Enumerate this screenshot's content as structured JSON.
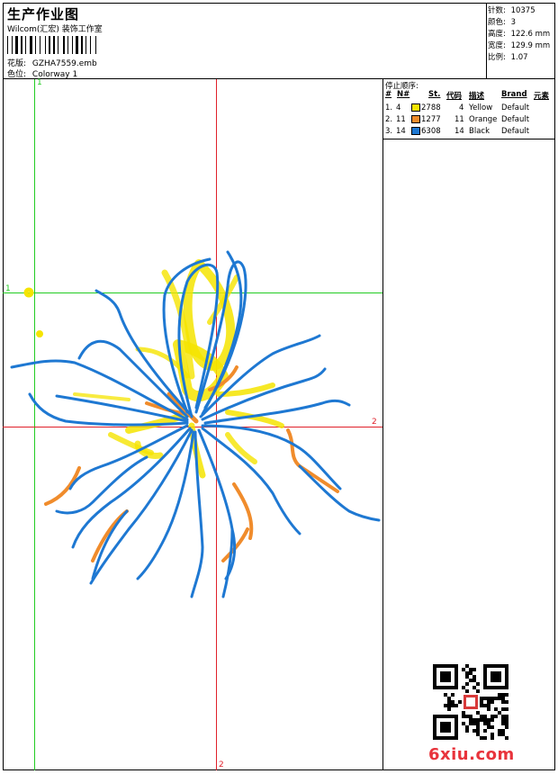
{
  "header": {
    "title": "生产作业图",
    "studio": "Wilcom(汇宏) 装饰工作室",
    "design_label": "花版:",
    "design_value": "GZHA7559.emb",
    "colorway_label": "色位:",
    "colorway_value": "Colorway 1"
  },
  "stats": [
    {
      "label": "针数:",
      "value": "10375"
    },
    {
      "label": "颜色:",
      "value": "3"
    },
    {
      "label": "高度:",
      "value": "122.6 mm"
    },
    {
      "label": "宽度:",
      "value": "129.9 mm"
    },
    {
      "label": "比例:",
      "value": "1.07"
    }
  ],
  "stop_sequence": {
    "title": "停止顺序:",
    "columns": [
      "#",
      "N#",
      "St.",
      "代码",
      "描述",
      "Brand",
      "元素"
    ],
    "rows": [
      {
        "idx": "1.",
        "n": "4",
        "color": "#f5e400",
        "st": "2788",
        "code": "4",
        "desc": "Yellow",
        "brand": "Default"
      },
      {
        "idx": "2.",
        "n": "11",
        "color": "#f08c2c",
        "st": "1277",
        "code": "11",
        "desc": "Orange",
        "brand": "Default"
      },
      {
        "idx": "3.",
        "n": "14",
        "color": "#1e78d2",
        "st": "6308",
        "code": "14",
        "desc": "Black",
        "brand": "Default"
      }
    ]
  },
  "axes": {
    "v_green_label": "1",
    "h_green_label": "1",
    "h_red_label": "2",
    "v_red_label": "2",
    "green_color": "#22cc22",
    "red_color": "#e0202a"
  },
  "thread_colors": {
    "yellow": "#f5e400",
    "orange": "#f08c2c",
    "blue": "#1e78d2"
  },
  "watermark": {
    "brand_text": "6xiu.com"
  }
}
